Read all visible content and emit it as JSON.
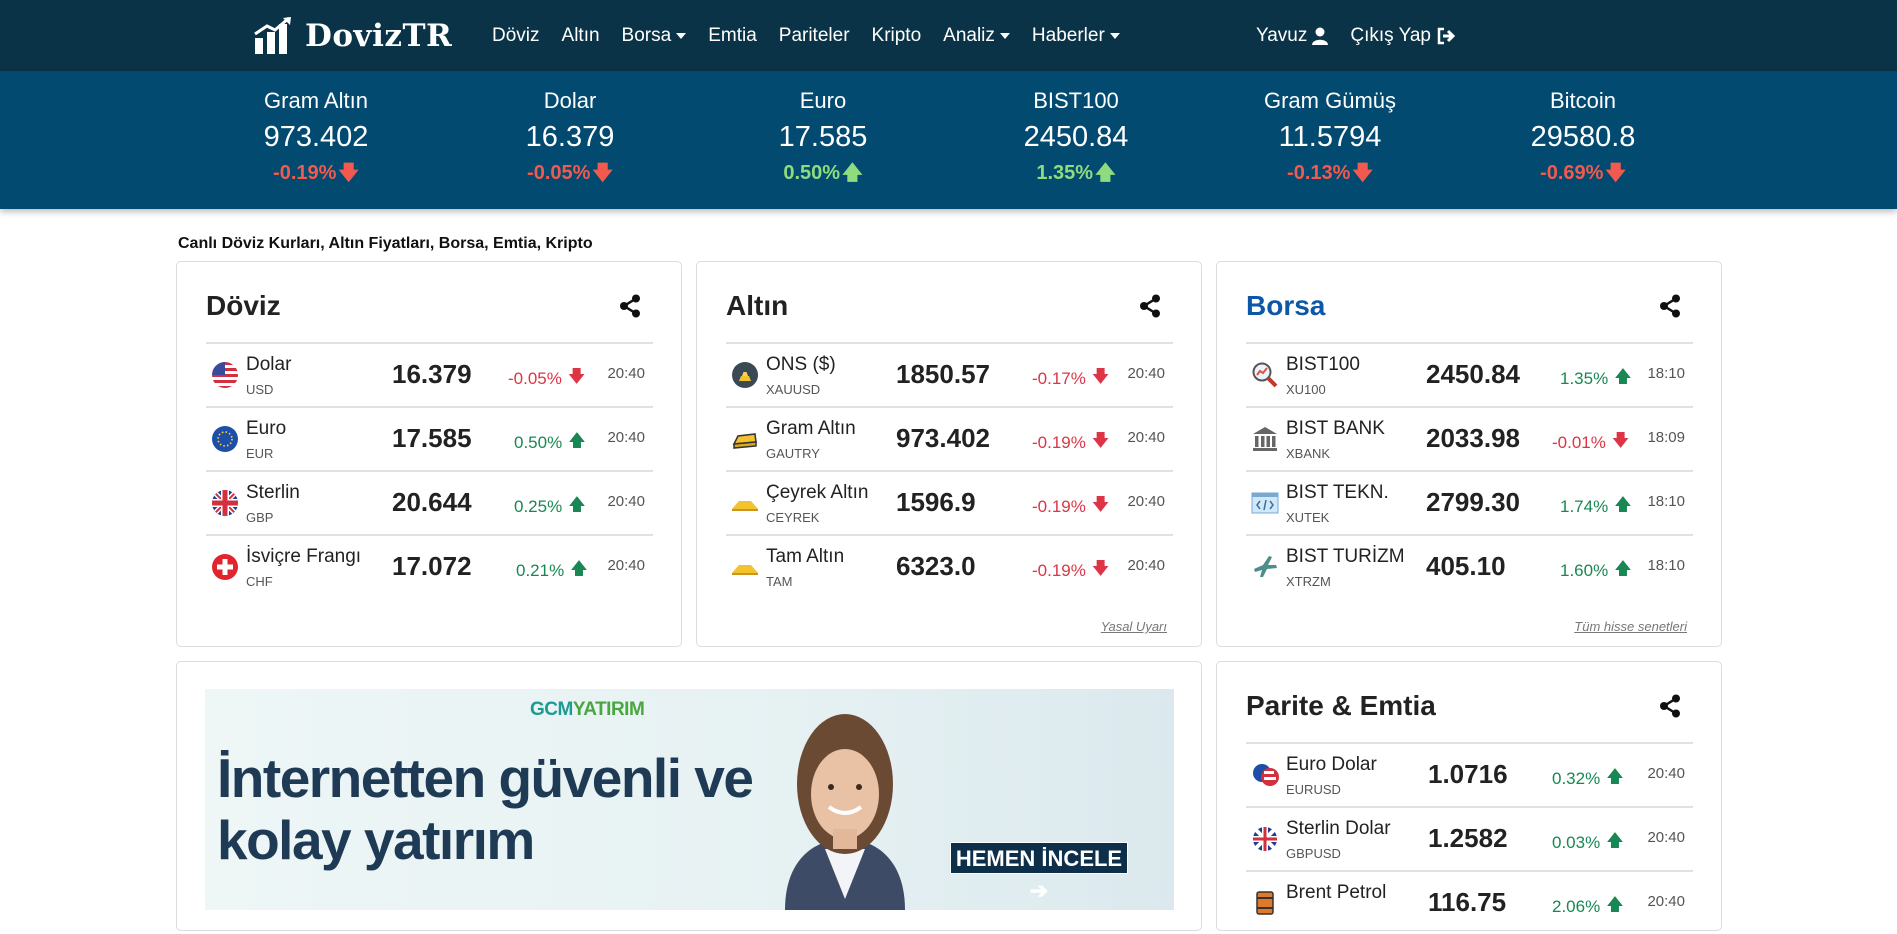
{
  "nav": {
    "brand": "DovizTR",
    "links": [
      "Döviz",
      "Altın",
      "Borsa",
      "Emtia",
      "Pariteler",
      "Kripto",
      "Analiz",
      "Haberler"
    ],
    "user": "Yavuz",
    "logout": "Çıkış Yap"
  },
  "ticker": [
    {
      "name": "Gram Altın",
      "value": "973.402",
      "change": "-0.19%",
      "dir": "down"
    },
    {
      "name": "Dolar",
      "value": "16.379",
      "change": "-0.05%",
      "dir": "down"
    },
    {
      "name": "Euro",
      "value": "17.585",
      "change": "0.50%",
      "dir": "up"
    },
    {
      "name": "BIST100",
      "value": "2450.84",
      "change": "1.35%",
      "dir": "up"
    },
    {
      "name": "Gram Gümüş",
      "value": "11.5794",
      "change": "-0.13%",
      "dir": "down"
    },
    {
      "name": "Bitcoin",
      "value": "29580.8",
      "change": "-0.69%",
      "dir": "down"
    }
  ],
  "tagline": "Canlı Döviz Kurları, Altın Fiyatları, Borsa, Emtia, Kripto",
  "doviz": {
    "title": "Döviz",
    "rows": [
      {
        "name": "Dolar",
        "code": "USD",
        "value": "16.379",
        "change": "-0.05%",
        "dir": "down",
        "time": "20:40",
        "icon": "us-flag-icon"
      },
      {
        "name": "Euro",
        "code": "EUR",
        "value": "17.585",
        "change": "0.50%",
        "dir": "up",
        "time": "20:40",
        "icon": "eu-flag-icon"
      },
      {
        "name": "Sterlin",
        "code": "GBP",
        "value": "20.644",
        "change": "0.25%",
        "dir": "up",
        "time": "20:40",
        "icon": "uk-flag-icon"
      },
      {
        "name": "İsviçre Frangı",
        "code": "CHF",
        "value": "17.072",
        "change": "0.21%",
        "dir": "up",
        "time": "20:40",
        "icon": "ch-flag-icon"
      }
    ]
  },
  "altin": {
    "title": "Altın",
    "footer": "Yasal Uyarı",
    "rows": [
      {
        "name": "ONS ($)",
        "code": "XAUUSD",
        "value": "1850.57",
        "change": "-0.17%",
        "dir": "down",
        "time": "20:40",
        "icon": "gold-ounce-icon"
      },
      {
        "name": "Gram Altın",
        "code": "GAUTRY",
        "value": "973.402",
        "change": "-0.19%",
        "dir": "down",
        "time": "20:40",
        "icon": "gold-bar-icon"
      },
      {
        "name": "Çeyrek Altın",
        "code": "CEYREK",
        "value": "1596.9",
        "change": "-0.19%",
        "dir": "down",
        "time": "20:40",
        "icon": "gold-pile-icon"
      },
      {
        "name": "Tam Altın",
        "code": "TAM",
        "value": "6323.0",
        "change": "-0.19%",
        "dir": "down",
        "time": "20:40",
        "icon": "gold-pile-icon"
      }
    ]
  },
  "borsa": {
    "title": "Borsa",
    "footer": "Tüm hisse senetleri",
    "rows": [
      {
        "name": "BIST100",
        "code": "XU100",
        "value": "2450.84",
        "change": "1.35%",
        "dir": "up",
        "time": "18:10",
        "icon": "magnifier-chart-icon"
      },
      {
        "name": "BIST BANK",
        "code": "XBANK",
        "value": "2033.98",
        "change": "-0.01%",
        "dir": "down",
        "time": "18:09",
        "icon": "bank-icon"
      },
      {
        "name": "BIST TEKN.",
        "code": "XUTEK",
        "value": "2799.30",
        "change": "1.74%",
        "dir": "up",
        "time": "18:10",
        "icon": "code-window-icon"
      },
      {
        "name": "BIST TURİZM",
        "code": "XTRZM",
        "value": "405.10",
        "change": "1.60%",
        "dir": "up",
        "time": "18:10",
        "icon": "airplane-icon"
      }
    ]
  },
  "parite": {
    "title": "Parite & Emtia",
    "rows": [
      {
        "name": "Euro Dolar",
        "code": "EURUSD",
        "value": "1.0716",
        "change": "0.32%",
        "dir": "up",
        "time": "20:40",
        "icon": "eu-us-flag-icon"
      },
      {
        "name": "Sterlin Dolar",
        "code": "GBPUSD",
        "value": "1.2582",
        "change": "0.03%",
        "dir": "up",
        "time": "20:40",
        "icon": "uk-us-flag-icon"
      },
      {
        "name": "Brent Petrol",
        "code": "",
        "value": "116.75",
        "change": "2.06%",
        "dir": "up",
        "time": "20:40",
        "icon": "oil-barrel-icon"
      }
    ]
  },
  "ad": {
    "logo_a": "GCM",
    "logo_b": "YATIRIM",
    "headline_1": "İnternetten güvenli ve",
    "headline_2": "kolay yatırım",
    "button": "HEMEN İNCELE ➔"
  },
  "colors": {
    "nav_bg": "#0b3347",
    "ticker_bg": "#024a70",
    "up": "#198754",
    "down": "#dc3545",
    "borsa_title": "#0d57a8"
  }
}
